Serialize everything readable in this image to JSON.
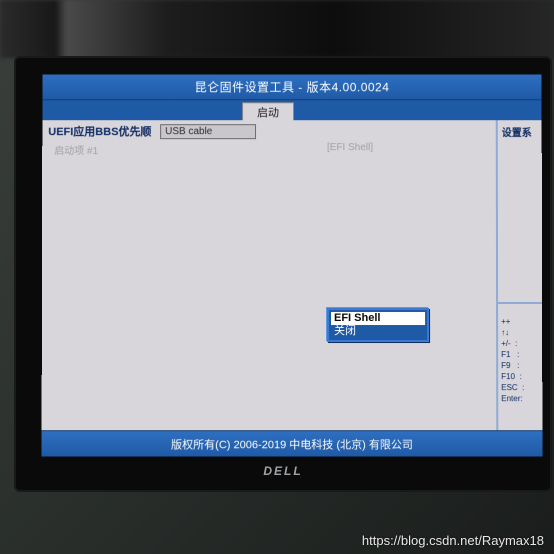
{
  "header": {
    "title": "昆仑固件设置工具 - 版本4.00.0024"
  },
  "tabs": {
    "active": "启动"
  },
  "main": {
    "heading": "UEFI应用BBS优先顺",
    "field_value": "USB cable",
    "boot_option_label": "启动项 #1",
    "boot_option_value": "[EFI Shell]"
  },
  "popup": {
    "options": [
      "EFI Shell",
      "关闭"
    ],
    "selected": "EFI Shell"
  },
  "side": {
    "title": "设置系",
    "keys": "++\n↑↓\n+/-  :\nF1   :\nF9   :\nF10  :\nESC  :\nEnter:"
  },
  "footer": {
    "copyright": "版权所有(C) 2006-2019 中电科技 (北京) 有限公司"
  },
  "monitor": {
    "brand": "DELL"
  },
  "watermark": {
    "url": "https://blog.csdn.net/Raymax18"
  }
}
